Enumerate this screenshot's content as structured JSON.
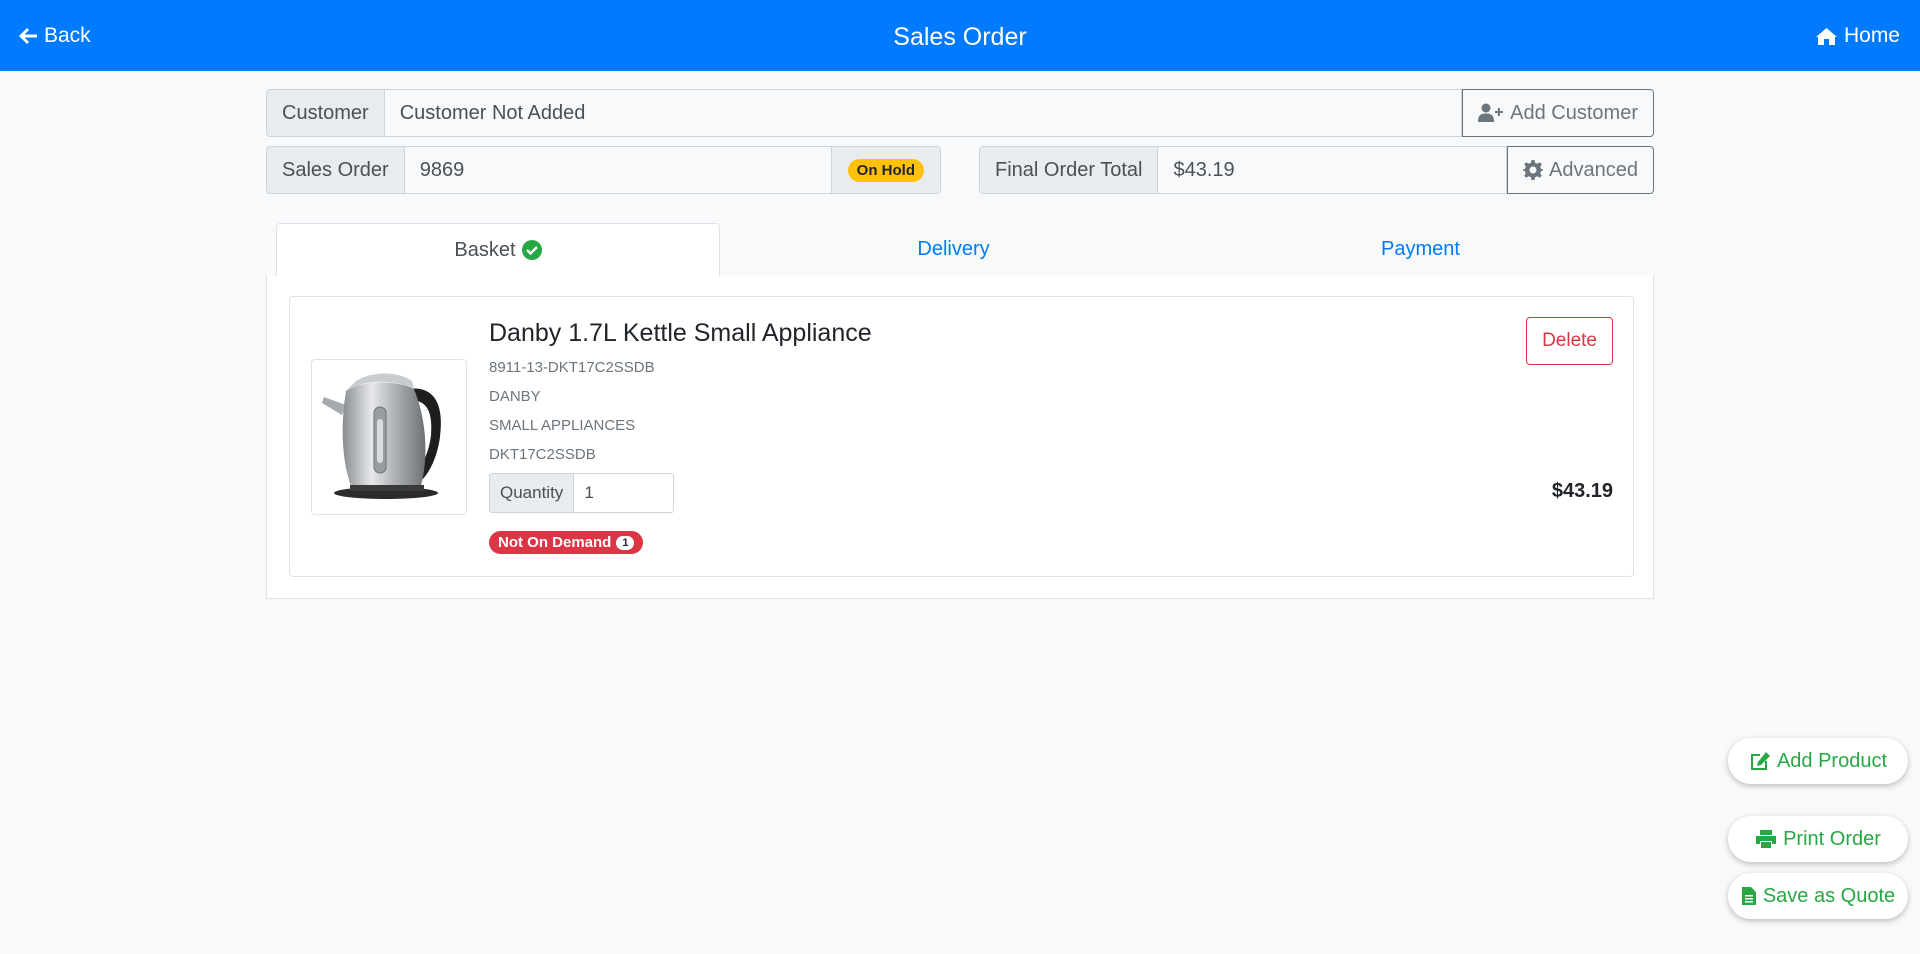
{
  "nav": {
    "back": "Back",
    "title": "Sales Order",
    "home": "Home"
  },
  "customer": {
    "label": "Customer",
    "value": "Customer Not Added",
    "button": "Add Customer"
  },
  "order": {
    "label": "Sales Order",
    "number": "9869",
    "status": "On Hold"
  },
  "total": {
    "label": "Final Order Total",
    "value": "$43.19",
    "button": "Advanced"
  },
  "tabs": [
    {
      "label": "Basket",
      "active": true
    },
    {
      "label": "Delivery",
      "active": false
    },
    {
      "label": "Payment",
      "active": false
    }
  ],
  "item": {
    "name": "Danby 1.7L Kettle Small Appliance",
    "sku": "8911-13-DKT17C2SSDB",
    "brand": "DANBY",
    "category": "SMALL APPLIANCES",
    "model": "DKT17C2SSDB",
    "quantity_label": "Quantity",
    "quantity": "1",
    "demand_badge": "Not On Demand",
    "demand_count": "1",
    "delete": "Delete",
    "price": "$43.19"
  },
  "actions": {
    "add_product": "Add Product",
    "print_order": "Print Order",
    "save_quote": "Save as Quote"
  },
  "colors": {
    "primary": "#007bff",
    "success": "#28a745",
    "danger": "#dc3545",
    "warning": "#ffc107"
  }
}
